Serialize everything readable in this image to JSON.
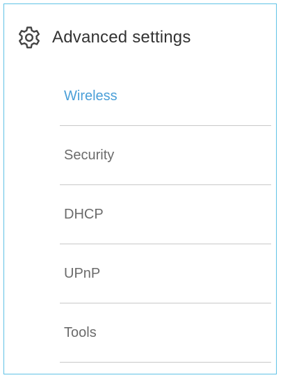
{
  "header": {
    "icon": "gear-icon",
    "title": "Advanced settings"
  },
  "menu": {
    "items": [
      {
        "label": "Wireless",
        "active": true
      },
      {
        "label": "Security",
        "active": false
      },
      {
        "label": "DHCP",
        "active": false
      },
      {
        "label": "UPnP",
        "active": false
      },
      {
        "label": "Tools",
        "active": false
      }
    ]
  },
  "colors": {
    "border": "#5fc2e6",
    "active": "#4a9fd8",
    "text": "#6b6b6b",
    "title": "#333333",
    "divider": "#c8c8c8"
  }
}
